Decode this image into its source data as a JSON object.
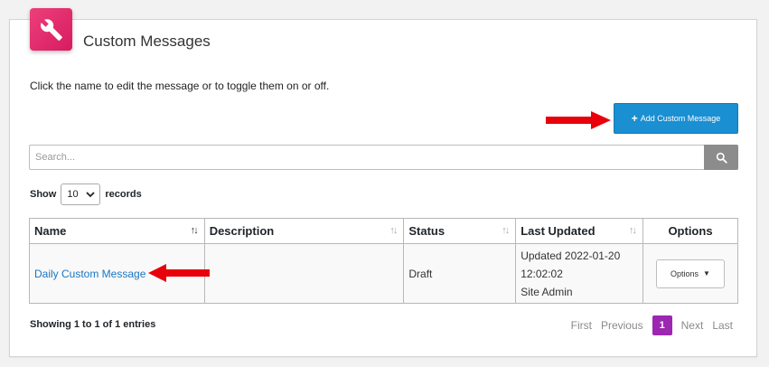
{
  "header": {
    "title": "Custom Messages",
    "icon": "wrench-icon",
    "icon_color": "#e91e63"
  },
  "intro_text": "Click the name to edit the message or to toggle them on or off.",
  "add_button": {
    "label": "Add Custom Message",
    "icon": "plus-icon",
    "color": "#1a8fd1"
  },
  "search": {
    "placeholder": "Search...",
    "value": ""
  },
  "length": {
    "show_label": "Show",
    "selected": "10",
    "records_label": "records"
  },
  "table": {
    "columns": [
      "Name",
      "Description",
      "Status",
      "Last Updated",
      "Options"
    ],
    "rows": [
      {
        "name": "Daily Custom Message",
        "description": "",
        "status": "Draft",
        "updated_line1": "Updated 2022-01-20",
        "updated_line2": "12:02:02",
        "updated_line3": "Site Admin",
        "options_label": "Options"
      }
    ]
  },
  "footer": {
    "info": "Showing 1 to 1 of 1 entries",
    "pager": {
      "first": "First",
      "previous": "Previous",
      "current": "1",
      "next": "Next",
      "last": "Last"
    }
  },
  "annotation_color": "#e8000b",
  "pager_active_color": "#9c27b0"
}
